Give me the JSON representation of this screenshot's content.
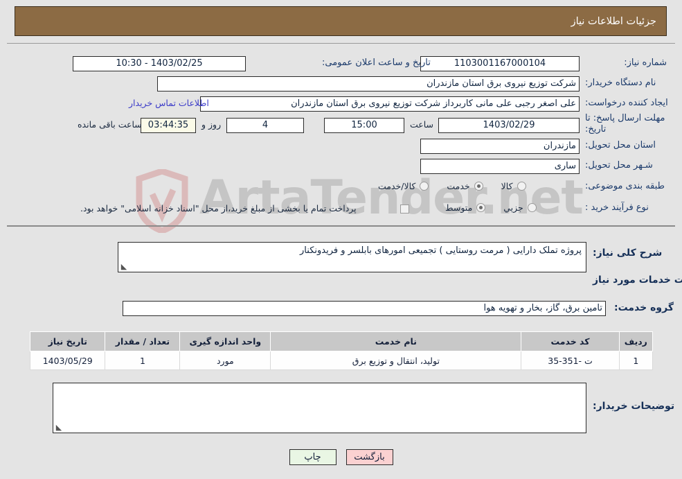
{
  "header": {
    "title": "جزئیات اطلاعات نیاز"
  },
  "form": {
    "need_number_label": "شماره نیاز:",
    "need_number_value": "1103001167000104",
    "announce_label": "تاریخ و ساعت اعلان عمومی:",
    "announce_value": "1403/02/25 - 10:30",
    "buyer_org_label": "نام دستگاه خریدار:",
    "buyer_org_value": "شرکت توزیع نیروی برق استان مازندران",
    "creator_label": "ایجاد کننده درخواست:",
    "creator_value": "علی اصغر رجبی علی مانی کاربرداز شرکت توزیع نیروی برق استان مازندران",
    "contact_link": "اطلاعات تماس خریدار",
    "deadline_label": "مهلت ارسال پاسخ: تا تاریخ:",
    "deadline_date": "1403/02/29",
    "deadline_hour_label": "ساعت",
    "deadline_hour": "15:00",
    "remaining_days": "4",
    "remaining_days_suffix": "روز و",
    "remaining_timer": "03:44:35",
    "remaining_suffix": "ساعت باقی مانده",
    "province_label": "استان محل تحویل:",
    "province_value": "مازندران",
    "city_label": "شـهر محل تحویل:",
    "city_value": "ساری",
    "category_label": "طبقه بندی موضوعی:",
    "category_options": [
      {
        "label": "کالا",
        "checked": false
      },
      {
        "label": "خدمت",
        "checked": true
      },
      {
        "label": "کالا/خدمت",
        "checked": false
      }
    ],
    "process_label": "نوع فرآیند خرید :",
    "process_options": [
      {
        "label": "جزیي",
        "checked": false
      },
      {
        "label": "متوسط",
        "checked": true
      }
    ],
    "treasury_checkbox_label": "پرداخت تمام یا بخشی از مبلغ خرید،از محل \"اسناد خزانه اسلامی\" خواهد بود.",
    "treasury_checked": false
  },
  "description": {
    "label": "شرح کلی نیاز:",
    "value": "پروژه تملک دارایی ( مرمت روستایی ) تجمیعی امورهای بابلسر و فریدونکنار"
  },
  "services_section": {
    "heading": "اطلاعات خدمات مورد نیاز",
    "group_label": "گروه خدمت:",
    "group_value": "تامین برق، گاز، بخار و تهویه هوا"
  },
  "table": {
    "columns": [
      "ردیف",
      "کد خدمت",
      "نام خدمت",
      "واحد اندازه گیری",
      "تعداد / مقدار",
      "تاریخ نیاز"
    ],
    "rows": [
      {
        "index": "1",
        "code": "ت -351-35",
        "name": "تولید، انتقال و توزیع برق",
        "unit": "مورد",
        "quantity": "1",
        "need_date": "1403/05/29"
      }
    ]
  },
  "buyer_notes": {
    "label": "توضیحات خریدار:",
    "value": ""
  },
  "footer": {
    "print_label": "چاپ",
    "back_label": "بازگشت"
  },
  "watermark": {
    "text": "ArtaTender.net"
  },
  "colors": {
    "header_bg": "#8c6b44",
    "page_bg": "#e4e4e4",
    "label_blue": "#1b3a6b",
    "link_blue": "#3b3bc8",
    "timer_bg": "#fbfbe8",
    "back_btn": "#fbd1d1",
    "print_btn": "#e9f6e4",
    "table_head": "#c8c8c8"
  }
}
